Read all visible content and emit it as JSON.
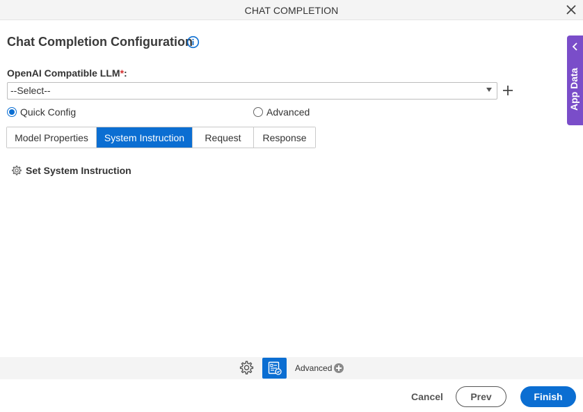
{
  "window": {
    "title": "CHAT COMPLETION"
  },
  "main": {
    "heading": "Chat Completion Configuration",
    "llm": {
      "label": "OpenAI Compatible LLM",
      "required_mark": "*",
      "colon": ":",
      "selected": "--Select--"
    },
    "config_mode": {
      "quick": "Quick Config",
      "advanced": "Advanced",
      "selected": "quick"
    },
    "tabs": [
      {
        "label": "Model Properties"
      },
      {
        "label": "System Instruction"
      },
      {
        "label": "Request"
      },
      {
        "label": "Response"
      }
    ],
    "active_tab": "System Instruction",
    "set_instruction": "Set System Instruction"
  },
  "sidebar": {
    "app_data": "App Data"
  },
  "toolbar": {
    "advanced": "Advanced"
  },
  "footer": {
    "cancel": "Cancel",
    "prev": "Prev",
    "finish": "Finish"
  },
  "icons": {
    "close": "close-icon",
    "info": "info-icon",
    "add": "plus-icon",
    "settings": "gear-icon",
    "form": "form-check-icon",
    "expand": "plus-circle-icon",
    "collapse": "chevron-left-icon"
  },
  "colors": {
    "accent": "#0b6ed2",
    "app_data_panel": "#7a4dc9",
    "required": "#d32f2f"
  }
}
